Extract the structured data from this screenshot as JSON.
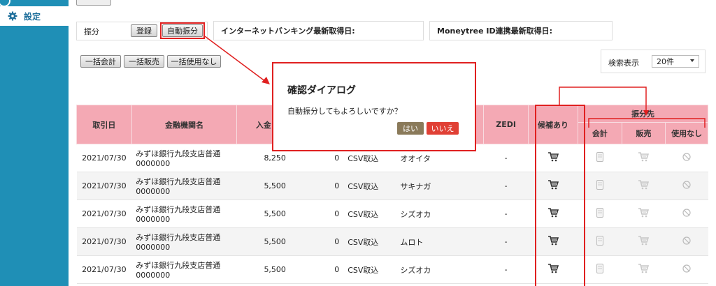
{
  "sidebar": {
    "settings_label": "設定"
  },
  "toolbar": {
    "furiwake_label": "振分",
    "register_label": "登録",
    "auto_label": "自動振分",
    "ib_label": "インターネットバンキング最新取得日:",
    "mt_label": "Moneytree ID連携最新取得日:",
    "bulk_kaikei": "一括会計",
    "bulk_hanbai": "一括販売",
    "bulk_none": "一括使用なし",
    "search_label": "検索表示",
    "search_value": "20件"
  },
  "table": {
    "headers": {
      "date": "取引日",
      "bank": "金融機関名",
      "deposit": "入金",
      "zedi": "ZEDI",
      "candidate": "候補あり",
      "dest": "振分先",
      "kaikei": "会計",
      "hanbai": "販売",
      "none": "使用なし"
    },
    "rows": [
      {
        "date": "2021/07/30",
        "bank1": "みずほ銀行九段支店普通",
        "bank2": "0000000",
        "deposit": "8,250",
        "withdraw": "0",
        "source": "CSV取込",
        "name": "オオイタ",
        "zedi": "-"
      },
      {
        "date": "2021/07/30",
        "bank1": "みずほ銀行九段支店普通",
        "bank2": "0000000",
        "deposit": "5,500",
        "withdraw": "0",
        "source": "CSV取込",
        "name": "サキナガ",
        "zedi": "-"
      },
      {
        "date": "2021/07/30",
        "bank1": "みずほ銀行九段支店普通",
        "bank2": "0000000",
        "deposit": "5,500",
        "withdraw": "0",
        "source": "CSV取込",
        "name": "シズオカ",
        "zedi": "-"
      },
      {
        "date": "2021/07/30",
        "bank1": "みずほ銀行九段支店普通",
        "bank2": "0000000",
        "deposit": "5,500",
        "withdraw": "0",
        "source": "CSV取込",
        "name": "ムロト",
        "zedi": "-"
      },
      {
        "date": "2021/07/30",
        "bank1": "みずほ銀行九段支店普通",
        "bank2": "0000000",
        "deposit": "5,500",
        "withdraw": "0",
        "source": "CSV取込",
        "name": "シズオカ",
        "zedi": "-"
      }
    ]
  },
  "dialog": {
    "title": "確認ダイアログ",
    "message": "自動振分してもよろしいですか？",
    "yes": "はい",
    "no": "いいえ"
  },
  "colors": {
    "sidebar": "#1f8fb6",
    "header": "#f4a9b4",
    "highlight": "#e02020"
  }
}
